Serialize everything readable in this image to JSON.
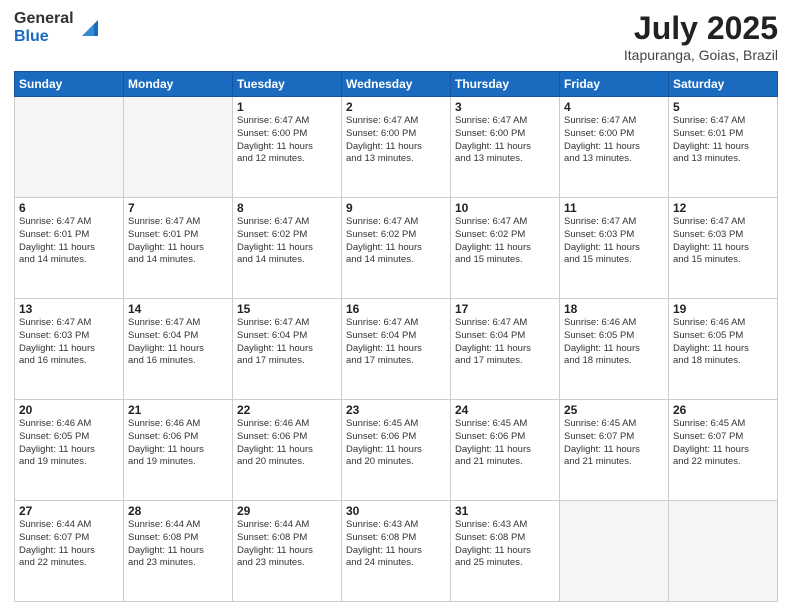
{
  "header": {
    "logo_general": "General",
    "logo_blue": "Blue",
    "title": "July 2025",
    "location": "Itapuranga, Goias, Brazil"
  },
  "weekdays": [
    "Sunday",
    "Monday",
    "Tuesday",
    "Wednesday",
    "Thursday",
    "Friday",
    "Saturday"
  ],
  "weeks": [
    [
      {
        "day": "",
        "info": ""
      },
      {
        "day": "",
        "info": ""
      },
      {
        "day": "1",
        "info": "Sunrise: 6:47 AM\nSunset: 6:00 PM\nDaylight: 11 hours\nand 12 minutes."
      },
      {
        "day": "2",
        "info": "Sunrise: 6:47 AM\nSunset: 6:00 PM\nDaylight: 11 hours\nand 13 minutes."
      },
      {
        "day": "3",
        "info": "Sunrise: 6:47 AM\nSunset: 6:00 PM\nDaylight: 11 hours\nand 13 minutes."
      },
      {
        "day": "4",
        "info": "Sunrise: 6:47 AM\nSunset: 6:00 PM\nDaylight: 11 hours\nand 13 minutes."
      },
      {
        "day": "5",
        "info": "Sunrise: 6:47 AM\nSunset: 6:01 PM\nDaylight: 11 hours\nand 13 minutes."
      }
    ],
    [
      {
        "day": "6",
        "info": "Sunrise: 6:47 AM\nSunset: 6:01 PM\nDaylight: 11 hours\nand 14 minutes."
      },
      {
        "day": "7",
        "info": "Sunrise: 6:47 AM\nSunset: 6:01 PM\nDaylight: 11 hours\nand 14 minutes."
      },
      {
        "day": "8",
        "info": "Sunrise: 6:47 AM\nSunset: 6:02 PM\nDaylight: 11 hours\nand 14 minutes."
      },
      {
        "day": "9",
        "info": "Sunrise: 6:47 AM\nSunset: 6:02 PM\nDaylight: 11 hours\nand 14 minutes."
      },
      {
        "day": "10",
        "info": "Sunrise: 6:47 AM\nSunset: 6:02 PM\nDaylight: 11 hours\nand 15 minutes."
      },
      {
        "day": "11",
        "info": "Sunrise: 6:47 AM\nSunset: 6:03 PM\nDaylight: 11 hours\nand 15 minutes."
      },
      {
        "day": "12",
        "info": "Sunrise: 6:47 AM\nSunset: 6:03 PM\nDaylight: 11 hours\nand 15 minutes."
      }
    ],
    [
      {
        "day": "13",
        "info": "Sunrise: 6:47 AM\nSunset: 6:03 PM\nDaylight: 11 hours\nand 16 minutes."
      },
      {
        "day": "14",
        "info": "Sunrise: 6:47 AM\nSunset: 6:04 PM\nDaylight: 11 hours\nand 16 minutes."
      },
      {
        "day": "15",
        "info": "Sunrise: 6:47 AM\nSunset: 6:04 PM\nDaylight: 11 hours\nand 17 minutes."
      },
      {
        "day": "16",
        "info": "Sunrise: 6:47 AM\nSunset: 6:04 PM\nDaylight: 11 hours\nand 17 minutes."
      },
      {
        "day": "17",
        "info": "Sunrise: 6:47 AM\nSunset: 6:04 PM\nDaylight: 11 hours\nand 17 minutes."
      },
      {
        "day": "18",
        "info": "Sunrise: 6:46 AM\nSunset: 6:05 PM\nDaylight: 11 hours\nand 18 minutes."
      },
      {
        "day": "19",
        "info": "Sunrise: 6:46 AM\nSunset: 6:05 PM\nDaylight: 11 hours\nand 18 minutes."
      }
    ],
    [
      {
        "day": "20",
        "info": "Sunrise: 6:46 AM\nSunset: 6:05 PM\nDaylight: 11 hours\nand 19 minutes."
      },
      {
        "day": "21",
        "info": "Sunrise: 6:46 AM\nSunset: 6:06 PM\nDaylight: 11 hours\nand 19 minutes."
      },
      {
        "day": "22",
        "info": "Sunrise: 6:46 AM\nSunset: 6:06 PM\nDaylight: 11 hours\nand 20 minutes."
      },
      {
        "day": "23",
        "info": "Sunrise: 6:45 AM\nSunset: 6:06 PM\nDaylight: 11 hours\nand 20 minutes."
      },
      {
        "day": "24",
        "info": "Sunrise: 6:45 AM\nSunset: 6:06 PM\nDaylight: 11 hours\nand 21 minutes."
      },
      {
        "day": "25",
        "info": "Sunrise: 6:45 AM\nSunset: 6:07 PM\nDaylight: 11 hours\nand 21 minutes."
      },
      {
        "day": "26",
        "info": "Sunrise: 6:45 AM\nSunset: 6:07 PM\nDaylight: 11 hours\nand 22 minutes."
      }
    ],
    [
      {
        "day": "27",
        "info": "Sunrise: 6:44 AM\nSunset: 6:07 PM\nDaylight: 11 hours\nand 22 minutes."
      },
      {
        "day": "28",
        "info": "Sunrise: 6:44 AM\nSunset: 6:08 PM\nDaylight: 11 hours\nand 23 minutes."
      },
      {
        "day": "29",
        "info": "Sunrise: 6:44 AM\nSunset: 6:08 PM\nDaylight: 11 hours\nand 23 minutes."
      },
      {
        "day": "30",
        "info": "Sunrise: 6:43 AM\nSunset: 6:08 PM\nDaylight: 11 hours\nand 24 minutes."
      },
      {
        "day": "31",
        "info": "Sunrise: 6:43 AM\nSunset: 6:08 PM\nDaylight: 11 hours\nand 25 minutes."
      },
      {
        "day": "",
        "info": ""
      },
      {
        "day": "",
        "info": ""
      }
    ]
  ]
}
